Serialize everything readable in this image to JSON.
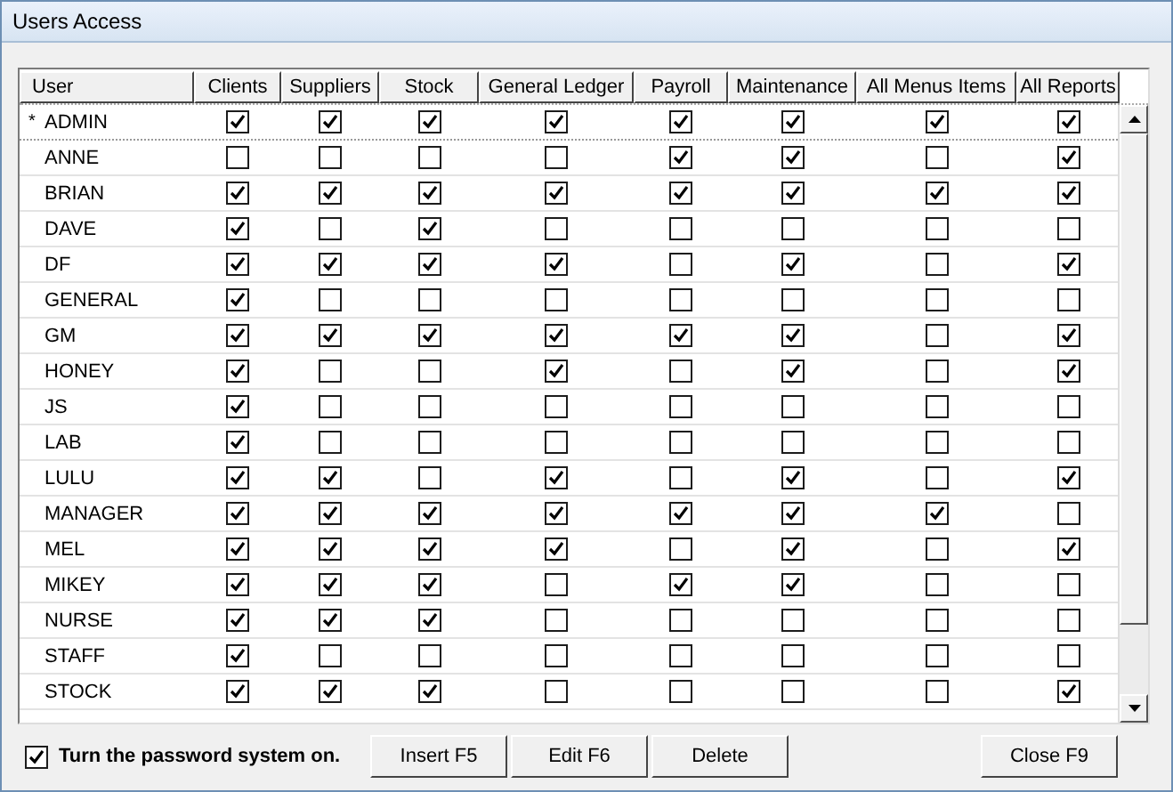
{
  "window": {
    "title": "Users Access"
  },
  "table": {
    "columns": [
      "User",
      "Clients",
      "Suppliers",
      "Stock",
      "General Ledger",
      "Payroll",
      "Maintenance",
      "All Menus Items",
      "All Reports"
    ],
    "rows": [
      {
        "indicator": "*",
        "user": "ADMIN",
        "current": true,
        "perms": [
          true,
          true,
          true,
          true,
          true,
          true,
          true,
          true
        ]
      },
      {
        "user": "ANNE",
        "current": false,
        "perms": [
          false,
          false,
          false,
          false,
          true,
          true,
          false,
          true
        ]
      },
      {
        "user": "BRIAN",
        "current": false,
        "perms": [
          true,
          true,
          true,
          true,
          true,
          true,
          true,
          true
        ]
      },
      {
        "user": "DAVE",
        "current": false,
        "perms": [
          true,
          false,
          true,
          false,
          false,
          false,
          false,
          false
        ]
      },
      {
        "user": "DF",
        "current": false,
        "perms": [
          true,
          true,
          true,
          true,
          false,
          true,
          false,
          true
        ]
      },
      {
        "user": "GENERAL",
        "current": false,
        "perms": [
          true,
          false,
          false,
          false,
          false,
          false,
          false,
          false
        ]
      },
      {
        "user": "GM",
        "current": false,
        "perms": [
          true,
          true,
          true,
          true,
          true,
          true,
          false,
          true
        ]
      },
      {
        "user": "HONEY",
        "current": false,
        "perms": [
          true,
          false,
          false,
          true,
          false,
          true,
          false,
          true
        ]
      },
      {
        "user": "JS",
        "current": false,
        "perms": [
          true,
          false,
          false,
          false,
          false,
          false,
          false,
          false
        ]
      },
      {
        "user": "LAB",
        "current": false,
        "perms": [
          true,
          false,
          false,
          false,
          false,
          false,
          false,
          false
        ]
      },
      {
        "user": "LULU",
        "current": false,
        "perms": [
          true,
          true,
          false,
          true,
          false,
          true,
          false,
          true
        ]
      },
      {
        "user": "MANAGER",
        "current": false,
        "perms": [
          true,
          true,
          true,
          true,
          true,
          true,
          true,
          false
        ]
      },
      {
        "user": "MEL",
        "current": false,
        "perms": [
          true,
          true,
          true,
          true,
          false,
          true,
          false,
          true
        ]
      },
      {
        "user": "MIKEY",
        "current": false,
        "perms": [
          true,
          true,
          true,
          false,
          true,
          true,
          false,
          false
        ]
      },
      {
        "user": "NURSE",
        "current": false,
        "perms": [
          true,
          true,
          true,
          false,
          false,
          false,
          false,
          false
        ]
      },
      {
        "user": "STAFF",
        "current": false,
        "perms": [
          true,
          false,
          false,
          false,
          false,
          false,
          false,
          false
        ]
      },
      {
        "user": "STOCK",
        "current": false,
        "perms": [
          true,
          true,
          true,
          false,
          false,
          false,
          false,
          true
        ]
      }
    ]
  },
  "password_system": {
    "label": "Turn the password system on.",
    "checked": true
  },
  "buttons": [
    "Insert F5",
    "Edit F6",
    "Delete"
  ],
  "close_button": "Close F9"
}
